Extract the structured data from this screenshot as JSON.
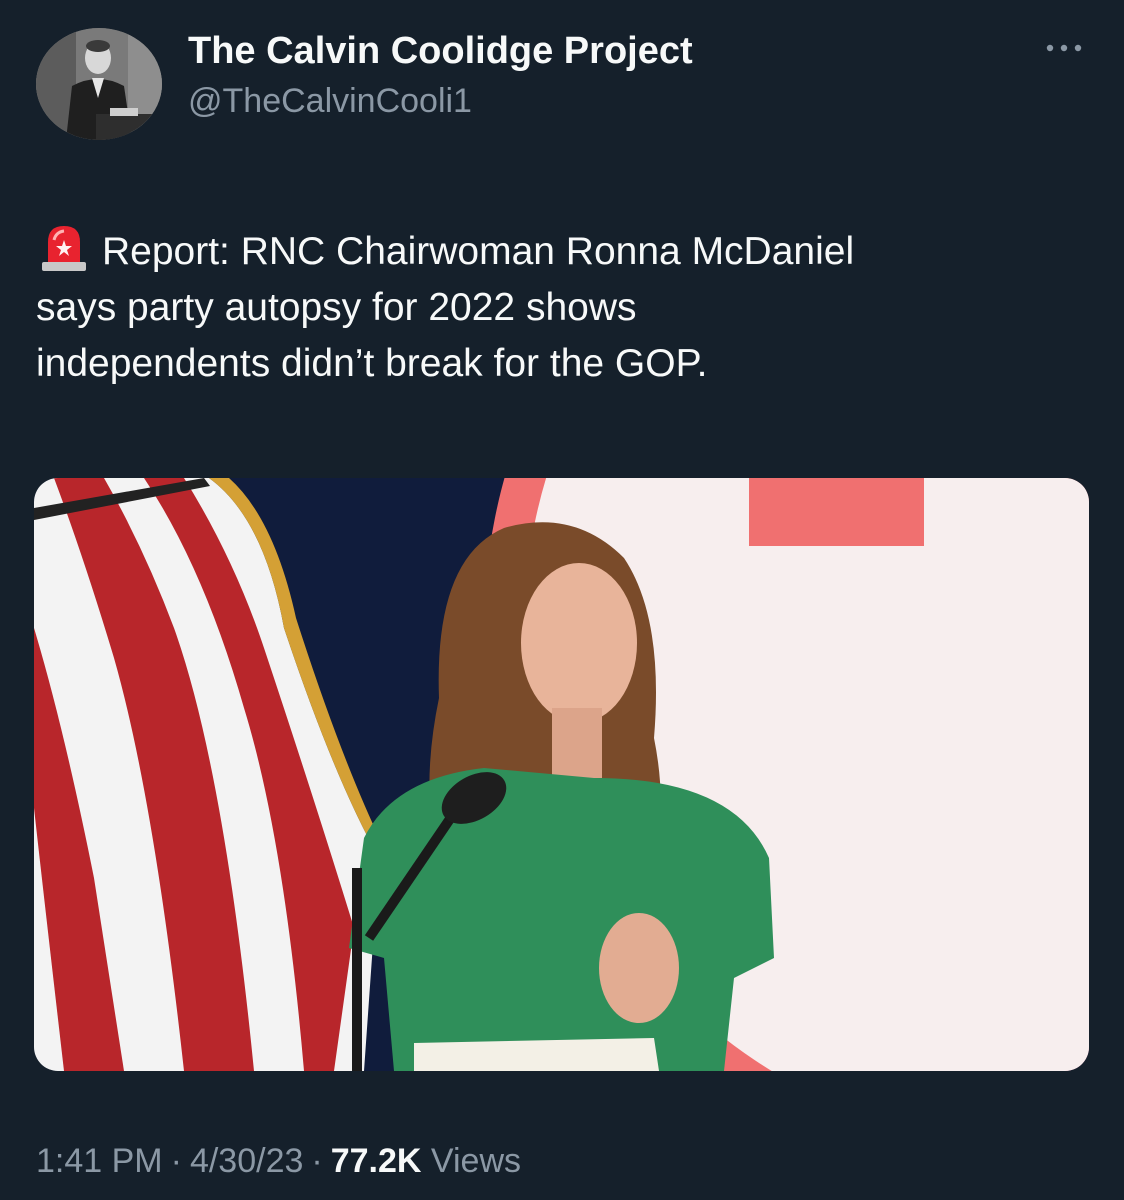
{
  "author": {
    "display_name": "The Calvin Coolidge Project",
    "handle": "@TheCalvinCooli1",
    "avatar_icon": "portrait-photo"
  },
  "tweet": {
    "emoji_icon": "police-car-light-icon",
    "text_lines": [
      "Report: RNC Chairwoman Ronna McDaniel",
      "says party autopsy for 2022 shows",
      "independents didn’t break for the GOP."
    ],
    "media_icon": "photo-speaker-at-podium"
  },
  "meta": {
    "time": "1:41 PM",
    "separator": "·",
    "date": "4/30/23",
    "views_count": "77.2K",
    "views_label": "Views"
  },
  "colors": {
    "background": "#15202b",
    "primary_text": "#f7f9f9",
    "secondary_text": "#8b98a5"
  }
}
